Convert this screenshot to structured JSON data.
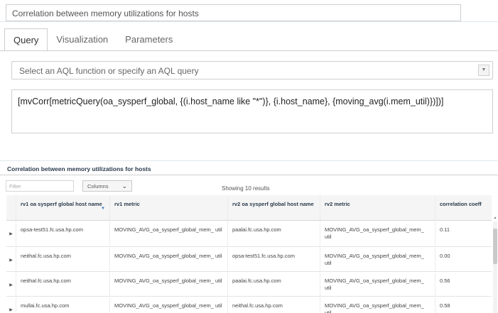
{
  "title": {
    "value": "Correlation between memory utilizations for hosts"
  },
  "tabs": [
    {
      "label": "Query",
      "active": true
    },
    {
      "label": "Visualization",
      "active": false
    },
    {
      "label": "Parameters",
      "active": false
    }
  ],
  "aql_select": {
    "placeholder": "Select an AQL function or specify an AQL query",
    "icon": "chevron-down-icon"
  },
  "query": {
    "text": "[mvCorr[metricQuery(oa_sysperf_global, {(i.host_name like \"*\")}, {i.host_name}, {moving_avg(i.mem_util)})])]"
  },
  "results": {
    "title": "Correlation between memory utilizations for hosts",
    "filter_placeholder": "Filter",
    "columns_label": "Columns",
    "showing": "Showing 10 results",
    "headers": [
      "rv1 oa sysperf global host name",
      "rv1 metric",
      "rv2 oa sysperf global host name",
      "rv2 metric",
      "correlation coeff"
    ],
    "rows": [
      [
        "opsa-test51.fc.usa.hp.com",
        "MOVING_AVG_oa_sysperf_global_mem_ util",
        "paalai.fc.usa.hp.com",
        "MOVING_AVG_oa_sysperf_global_mem_ util",
        "0.11"
      ],
      [
        "neithal.fc.usa.hp.com",
        "MOVING_AVG_oa_sysperf_global_mem_ util",
        "opsa-test51.fc.usa.hp.com",
        "MOVING_AVG_oa_sysperf_global_mem_ util",
        "0.00"
      ],
      [
        "neithal.fc.usa.hp.com",
        "MOVING_AVG_oa_sysperf_global_mem_ util",
        "paalai.fc.usa.hp.com",
        "MOVING_AVG_oa_sysperf_global_mem_ util",
        "0.56"
      ],
      [
        "mullai.fc.usa.hp.com",
        "MOVING_AVG_oa_sysperf_global_mem_ util",
        "neithal.fc.usa.hp.com",
        "MOVING_AVG_oa_sysperf_global_mem_ util",
        "0.58"
      ]
    ]
  }
}
